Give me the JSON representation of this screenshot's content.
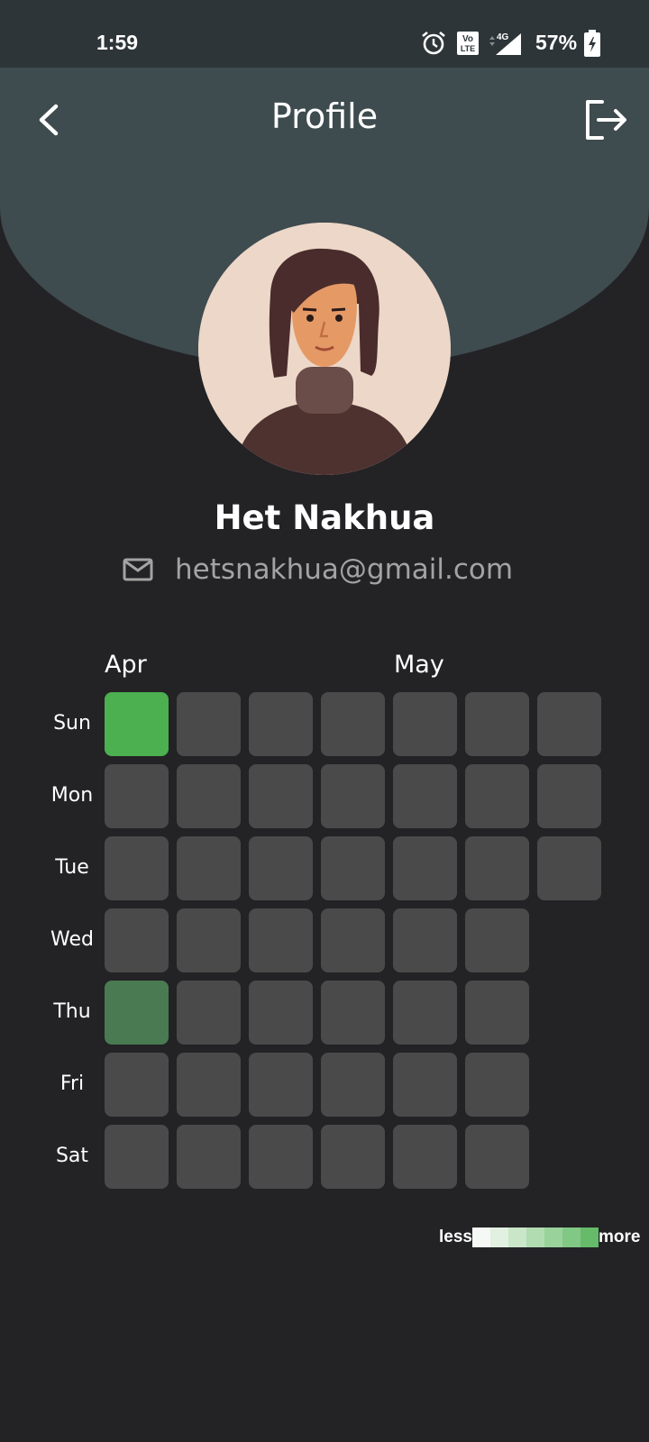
{
  "status_bar": {
    "time": "1:59",
    "battery": "57%",
    "network": "4G",
    "volte": "Vo LTE"
  },
  "header": {
    "title": "Profile",
    "back_icon": "chevron-left-icon",
    "logout_icon": "logout-icon"
  },
  "profile": {
    "name": "Het Nakhua",
    "email": "hetsnakhua@gmail.com"
  },
  "heatmap": {
    "months": [
      "Apr",
      "May"
    ],
    "days": [
      "Sun",
      "Mon",
      "Tue",
      "Wed",
      "Thu",
      "Fri",
      "Sat"
    ],
    "column_counts": [
      7,
      7,
      7,
      6,
      6,
      6,
      6
    ],
    "active_cells": [
      {
        "day": "Sun",
        "week": 1,
        "color": "#4caf50"
      },
      {
        "day": "Thu",
        "week": 1,
        "color": "#4a7a52"
      }
    ],
    "empty_color": "#4a4a4a",
    "legend": {
      "less_label": "less",
      "more_label": "more",
      "colors": [
        "#f5f8f5",
        "#e1f0e1",
        "#c9e6c9",
        "#b1dcb2",
        "#99d29b",
        "#82c885",
        "#66bb6a"
      ]
    }
  }
}
